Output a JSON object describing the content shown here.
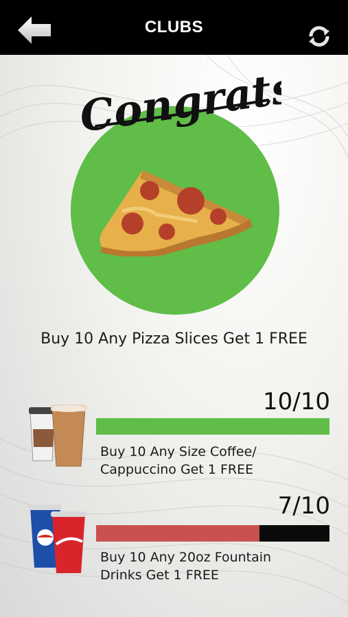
{
  "header": {
    "title": "CLUBS",
    "back_icon": "back-arrow-icon",
    "refresh_icon": "refresh-icon",
    "background": "#000000"
  },
  "featured": {
    "congrats_text": "Congrats!",
    "circle_color": "#5fbd48",
    "image": "pizza-slice-image",
    "description": "Buy 10 Any Pizza Slices Get 1 FREE"
  },
  "clubs": [
    {
      "image": "coffee-cups-image",
      "count_text": "10/10",
      "progress": 1.0,
      "bar_color": "#5fbd48",
      "description_line1": "Buy 10 Any Size Coffee/",
      "description_line2": "Cappuccino Get 1 FREE"
    },
    {
      "image": "fountain-drinks-image",
      "count_text": "7/10",
      "progress": 0.7,
      "bar_color": "#c9524f",
      "description_line1": "Buy 10 Any 20oz Fountain",
      "description_line2": "Drinks Get 1 FREE"
    }
  ]
}
